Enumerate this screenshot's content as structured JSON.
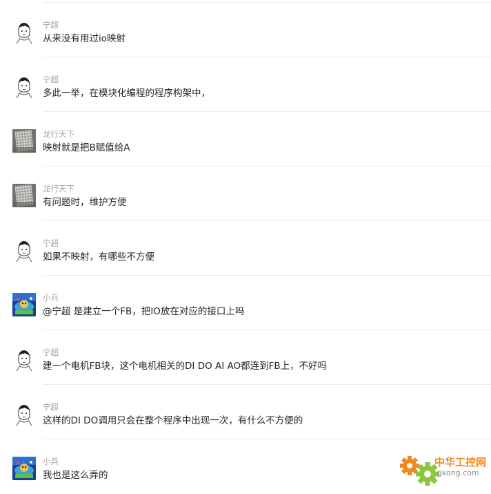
{
  "messages": [
    {
      "sender": "宁超",
      "avatar": "sketch-face-avatar",
      "text": "从来没有用过io映射"
    },
    {
      "sender": "宁超",
      "avatar": "sketch-face-avatar",
      "text": "多此一举，在模块化编程的程序构架中，"
    },
    {
      "sender": "龙行天下",
      "avatar": "photo-avatar",
      "text": "映射就是把B赋值给A"
    },
    {
      "sender": "龙行天下",
      "avatar": "photo-avatar",
      "text": "有问题时，维护方便"
    },
    {
      "sender": "宁超",
      "avatar": "sketch-face-avatar",
      "text": "如果不映射，有哪些不方便"
    },
    {
      "sender": "小兵",
      "avatar": "game-avatar",
      "text": "@宁超 是建立一个FB，把IO放在对应的接口上吗"
    },
    {
      "sender": "宁超",
      "avatar": "sketch-face-avatar",
      "text": "建一个电机FB块，这个电机相关的DI DO AI AO都连到FB上，不好吗"
    },
    {
      "sender": "宁超",
      "avatar": "sketch-face-avatar",
      "text": "这样的DI DO调用只会在整个程序中出现一次，有什么不方便的"
    },
    {
      "sender": "小兵",
      "avatar": "game-avatar",
      "text": "我也是这么弄的"
    }
  ],
  "watermark": {
    "brand": "中华工控网",
    "url": "gkong.com",
    "colors": {
      "orange": "#f08a1c",
      "green": "#8cc63f"
    }
  }
}
